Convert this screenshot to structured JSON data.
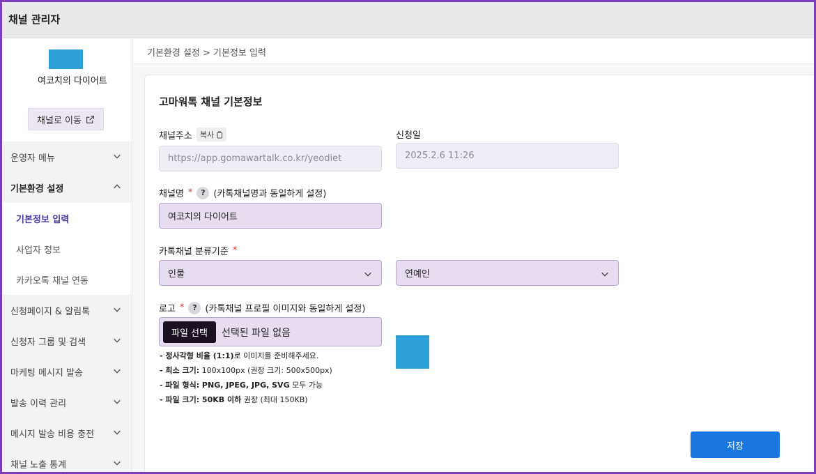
{
  "app": {
    "title": "채널 관리자"
  },
  "sidebar": {
    "profile": {
      "name": "여코치의 다이어트",
      "go_button": "채널로 이동"
    },
    "menu": [
      {
        "label": "운영자 메뉴",
        "state": "collapsed"
      },
      {
        "label": "기본환경 설정",
        "state": "expanded",
        "children": [
          {
            "label": "기본정보 입력",
            "active": true
          },
          {
            "label": "사업자 정보",
            "active": false
          },
          {
            "label": "카카오톡 채널 연동",
            "active": false
          }
        ]
      },
      {
        "label": "신청페이지 & 알림톡",
        "state": "collapsed"
      },
      {
        "label": "신청자 그룹 및 검색",
        "state": "collapsed"
      },
      {
        "label": "마케팅 메시지 발송",
        "state": "collapsed"
      },
      {
        "label": "발송 이력 관리",
        "state": "collapsed"
      },
      {
        "label": "메시지 발송 비용 충전",
        "state": "collapsed"
      },
      {
        "label": "채널 노출 통계",
        "state": "collapsed"
      }
    ]
  },
  "breadcrumb": "기본환경 설정 > 기본정보 입력",
  "form": {
    "title": "고마워톡 채널 기본정보",
    "channel_url": {
      "label": "채널주소",
      "copy_label": "복사",
      "value": "https://app.gomawartalk.co.kr/yeodiet"
    },
    "apply_date": {
      "label": "신청일",
      "value": "2025.2.6 11:26"
    },
    "channel_name": {
      "label": "채널명",
      "required": "*",
      "help": "?",
      "hint": "(카톡채널명과 동일하게 설정)",
      "value": "여코치의 다이어트"
    },
    "category": {
      "label": "카톡채널 분류기준",
      "required": "*",
      "primary": "인물",
      "secondary": "연예인"
    },
    "logo": {
      "label": "로고",
      "required": "*",
      "help": "?",
      "hint": "(카톡채널 프로필 이미지와 동일하게 설정)",
      "file_button": "파일 선택",
      "file_status": "선택된 파일 없음",
      "notes": [
        {
          "bold": "- 정사각형 비율 (1:1)",
          "rest": "로 이미지를 준비해주세요."
        },
        {
          "bold": "- 최소 크기:",
          "rest": " 100x100px (권장 크기: 500x500px)"
        },
        {
          "bold": "- 파일 형식: PNG, JPEG, JPG, SVG",
          "rest": " 모두 가능"
        },
        {
          "bold": "- 파일 크기: 50KB 이하",
          "rest": " 권장 (최대 150KB)"
        }
      ]
    },
    "save_label": "저장"
  },
  "colors": {
    "accent": "#1a77e0",
    "frame": "#7a3fb8",
    "logo": "#2e9fd8",
    "field_fill": "#e8dcf0",
    "active_menu": "#4b3aa6"
  }
}
